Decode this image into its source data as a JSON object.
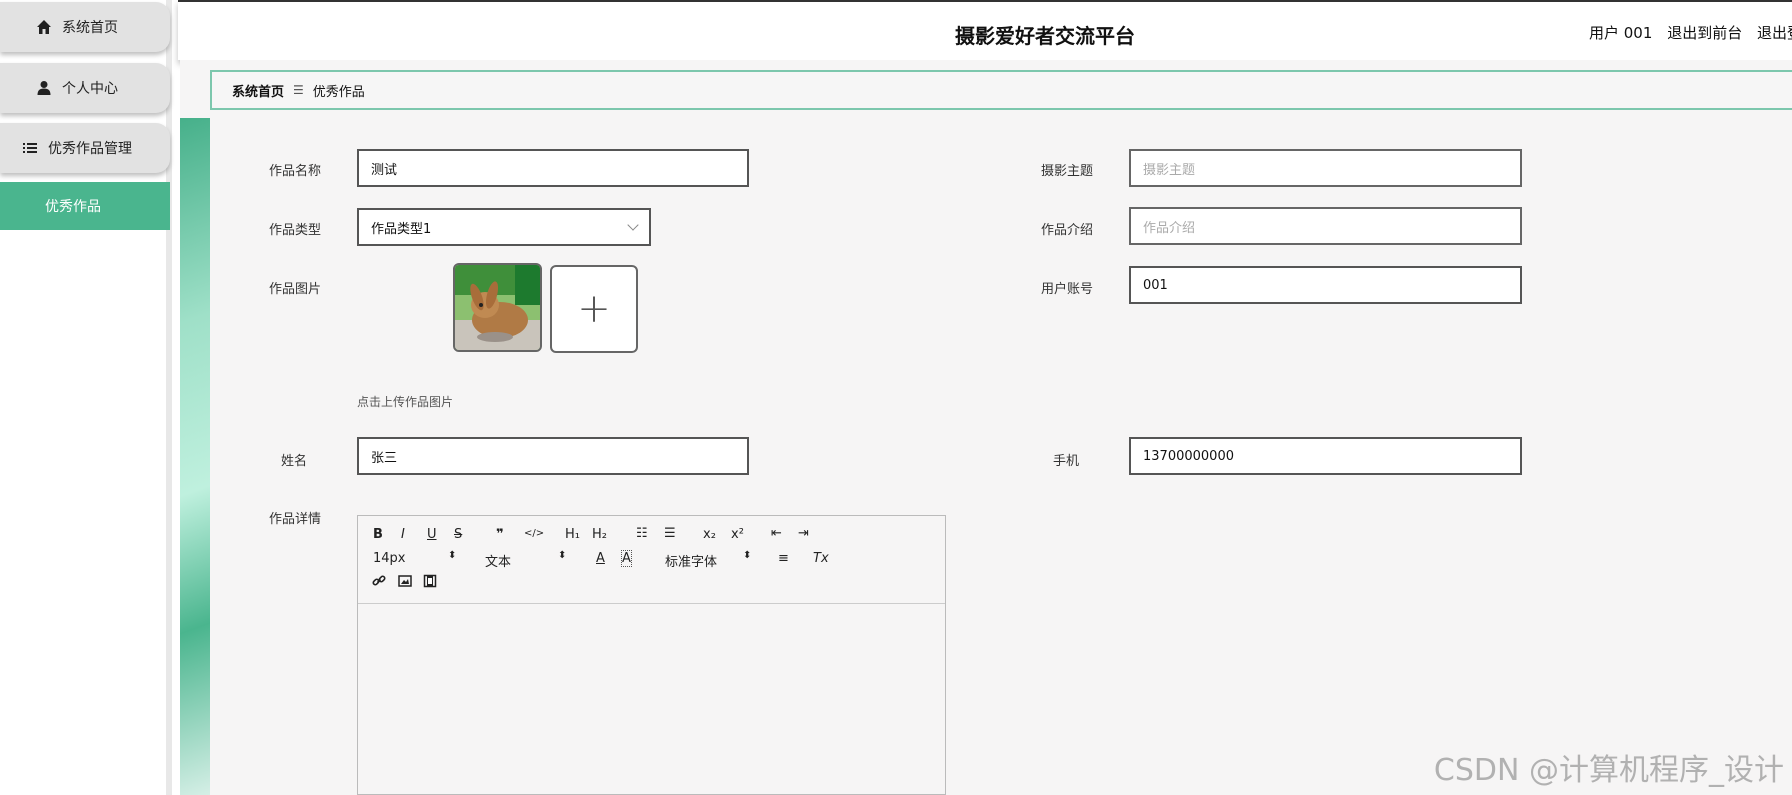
{
  "app": {
    "title": "摄影爱好者交流平台",
    "user_label": "用户 001",
    "to_front_label": "退出到前台",
    "logout_label": "退出登"
  },
  "sidebar": {
    "items": [
      {
        "label": "系统首页",
        "icon": "home-icon"
      },
      {
        "label": "个人中心",
        "icon": "user-icon"
      },
      {
        "label": "优秀作品管理",
        "icon": "menu-list-icon"
      }
    ],
    "sub_item": "优秀作品",
    "accent_color": "#4ab58e"
  },
  "breadcrumb": {
    "home": "系统首页",
    "separator": "☰",
    "current": "优秀作品"
  },
  "form": {
    "work_name_label": "作品名称",
    "work_name_value": "测试",
    "theme_label": "摄影主题",
    "theme_placeholder": "摄影主题",
    "work_type_label": "作品类型",
    "work_type_value": "作品类型1",
    "intro_label": "作品介绍",
    "intro_placeholder": "作品介绍",
    "image_label": "作品图片",
    "upload_symbol": "+",
    "upload_hint": "点击上传作品图片",
    "account_label": "用户账号",
    "account_value": "001",
    "name_label": "姓名",
    "name_value": "张三",
    "phone_label": "手机",
    "phone_value": "13700000000",
    "detail_label": "作品详情"
  },
  "editor": {
    "bold": "B",
    "italic": "I",
    "underline": "U",
    "strike": "S",
    "quote": "❞",
    "code": "</>",
    "h1": "H₁",
    "h2": "H₂",
    "ordered_list": "☷",
    "bullet_list": "☰",
    "subscript": "x₂",
    "superscript": "x²",
    "outdent": "⇤",
    "indent": "⇥",
    "font_size": "14px",
    "text_style": "文本",
    "font_color": "A",
    "bg_color": "A",
    "font_family": "标准字体",
    "align": "≡",
    "clear_format": "Tx",
    "link": "🔗",
    "image": "▣",
    "video": "▤"
  },
  "watermark": "CSDN @计算机程序_设计"
}
